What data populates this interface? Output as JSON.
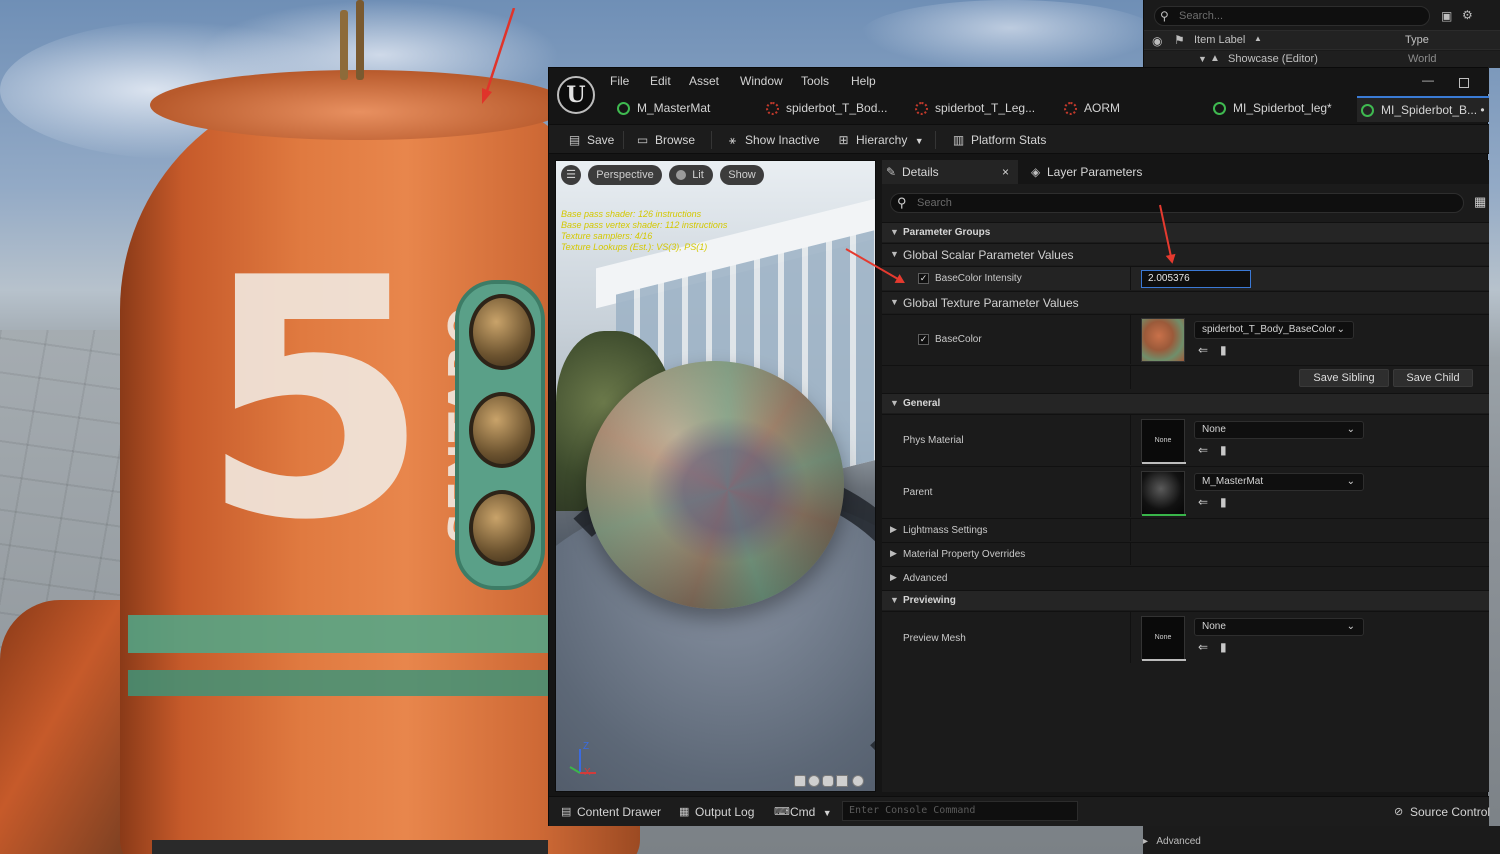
{
  "background_editor": {
    "brand_number": "5",
    "brand_name": "SENTARO",
    "outliner": {
      "search_placeholder": "Search...",
      "column_label": "Item Label",
      "column_sort": "▲",
      "column_type": "Type",
      "row_label": "Showcase (Editor)",
      "row_type": "World"
    },
    "advanced_label": "Advanced"
  },
  "editor": {
    "logo": "U",
    "menu": [
      "File",
      "Edit",
      "Asset",
      "Window",
      "Tools",
      "Help"
    ],
    "window_minimize": "—",
    "tabs": [
      {
        "label": "M_MasterMat",
        "color": "#3fb950"
      },
      {
        "label": "spiderbot_T_Bod...",
        "color": "#c0392b"
      },
      {
        "label": "spiderbot_T_Leg...",
        "color": "#c0392b"
      },
      {
        "label": "AORM",
        "color": "#c0392b"
      },
      {
        "label": "MI_Spiderbot_leg*",
        "color": "#3fb950"
      },
      {
        "label": "MI_Spiderbot_B... •",
        "color": "#3fb950"
      }
    ],
    "toolbar": {
      "save": "Save",
      "browse": "Browse",
      "show_inactive": "Show Inactive",
      "hierarchy": "Hierarchy",
      "platform_stats": "Platform Stats"
    }
  },
  "preview": {
    "menu_icon": "☰",
    "perspective": "Perspective",
    "lit": "Lit",
    "show": "Show",
    "stats": [
      "Base pass shader: 126 instructions",
      "Base pass vertex shader: 112 instructions",
      "Texture samplers: 4/16",
      "Texture Lookups (Est.): VS(3), PS(1)"
    ],
    "axis_z": "Z",
    "axis_x": "X"
  },
  "details": {
    "tab_details": "Details",
    "tab_close": "×",
    "tab_layers": "Layer Parameters",
    "search_placeholder": "Search",
    "sections": {
      "parameter_groups": "Parameter Groups",
      "global_scalar": "Global Scalar Parameter Values",
      "global_texture": "Global Texture Parameter Values",
      "general": "General",
      "lightmass": "Lightmass Settings",
      "material_overrides": "Material Property Overrides",
      "advanced": "Advanced",
      "previewing": "Previewing"
    },
    "scalar_param": {
      "name": "BaseColor Intensity",
      "value": "2.005376",
      "enabled": true
    },
    "texture_param": {
      "name": "BaseColor",
      "value": "spiderbot_T_Body_BaseColor",
      "enabled": true
    },
    "save_sibling": "Save Sibling",
    "save_child": "Save Child",
    "phys_material": {
      "name": "Phys Material",
      "value": "None",
      "thumb": "None"
    },
    "parent": {
      "name": "Parent",
      "value": "M_MasterMat"
    },
    "preview_mesh": {
      "name": "Preview Mesh",
      "value": "None",
      "thumb": "None"
    }
  },
  "statusbar": {
    "content_drawer": "Content Drawer",
    "output_log": "Output Log",
    "cmd": "Cmd",
    "console_placeholder": "Enter Console Command",
    "source_control": "Source Control"
  }
}
